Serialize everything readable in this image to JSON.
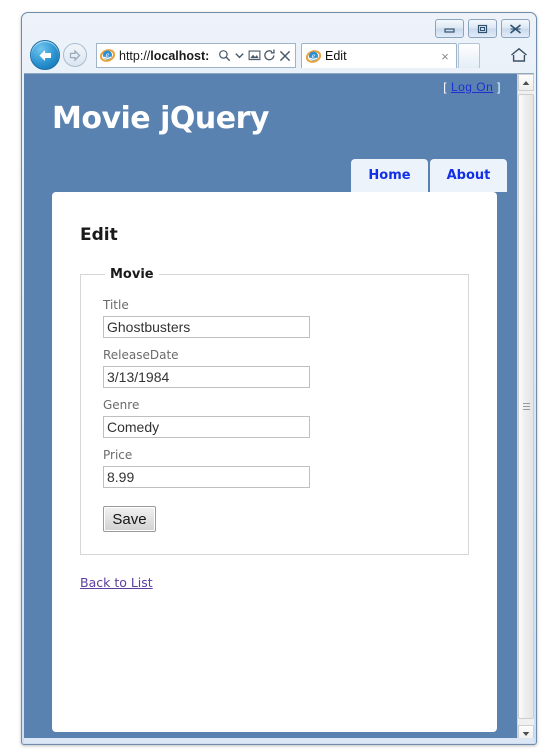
{
  "browser": {
    "window_buttons": [
      {
        "name": "minimize",
        "glyph": "minimize-icon"
      },
      {
        "name": "restore",
        "glyph": "restore-icon"
      },
      {
        "name": "close",
        "glyph": "close-icon"
      }
    ],
    "back_label": "Back",
    "forward_label": "Forward",
    "address_value": "http://localhost:",
    "address_prefix": "http://",
    "address_host": "localhost:",
    "address_icons": [
      "search-icon",
      "dropdown-arrow-icon",
      "compatibility-view-icon",
      "refresh-icon",
      "stop-icon"
    ],
    "tab_title": "Edit",
    "tab_close_label": "×",
    "new_tab_label": "New Tab",
    "home_label": "Home"
  },
  "site": {
    "title": "Movie jQuery",
    "logon_bracket_open": "[",
    "logon_link": "Log On",
    "logon_bracket_close": "]",
    "nav": [
      {
        "label": "Home"
      },
      {
        "label": "About"
      }
    ]
  },
  "main": {
    "heading": "Edit",
    "fieldset_legend": "Movie",
    "fields": [
      {
        "label": "Title",
        "value": "Ghostbusters"
      },
      {
        "label": "ReleaseDate",
        "value": "3/13/1984"
      },
      {
        "label": "Genre",
        "value": "Comedy"
      },
      {
        "label": "Price",
        "value": "8.99"
      }
    ],
    "save_label": "Save",
    "back_to_list_label": "Back to List"
  },
  "colors": {
    "header_blue": "#5a82b0",
    "nav_tab_bg": "#edf3fa",
    "nav_tab_text": "#1230e8",
    "link_visited": "#5c3fa0",
    "card_bg": "#ffffff"
  }
}
